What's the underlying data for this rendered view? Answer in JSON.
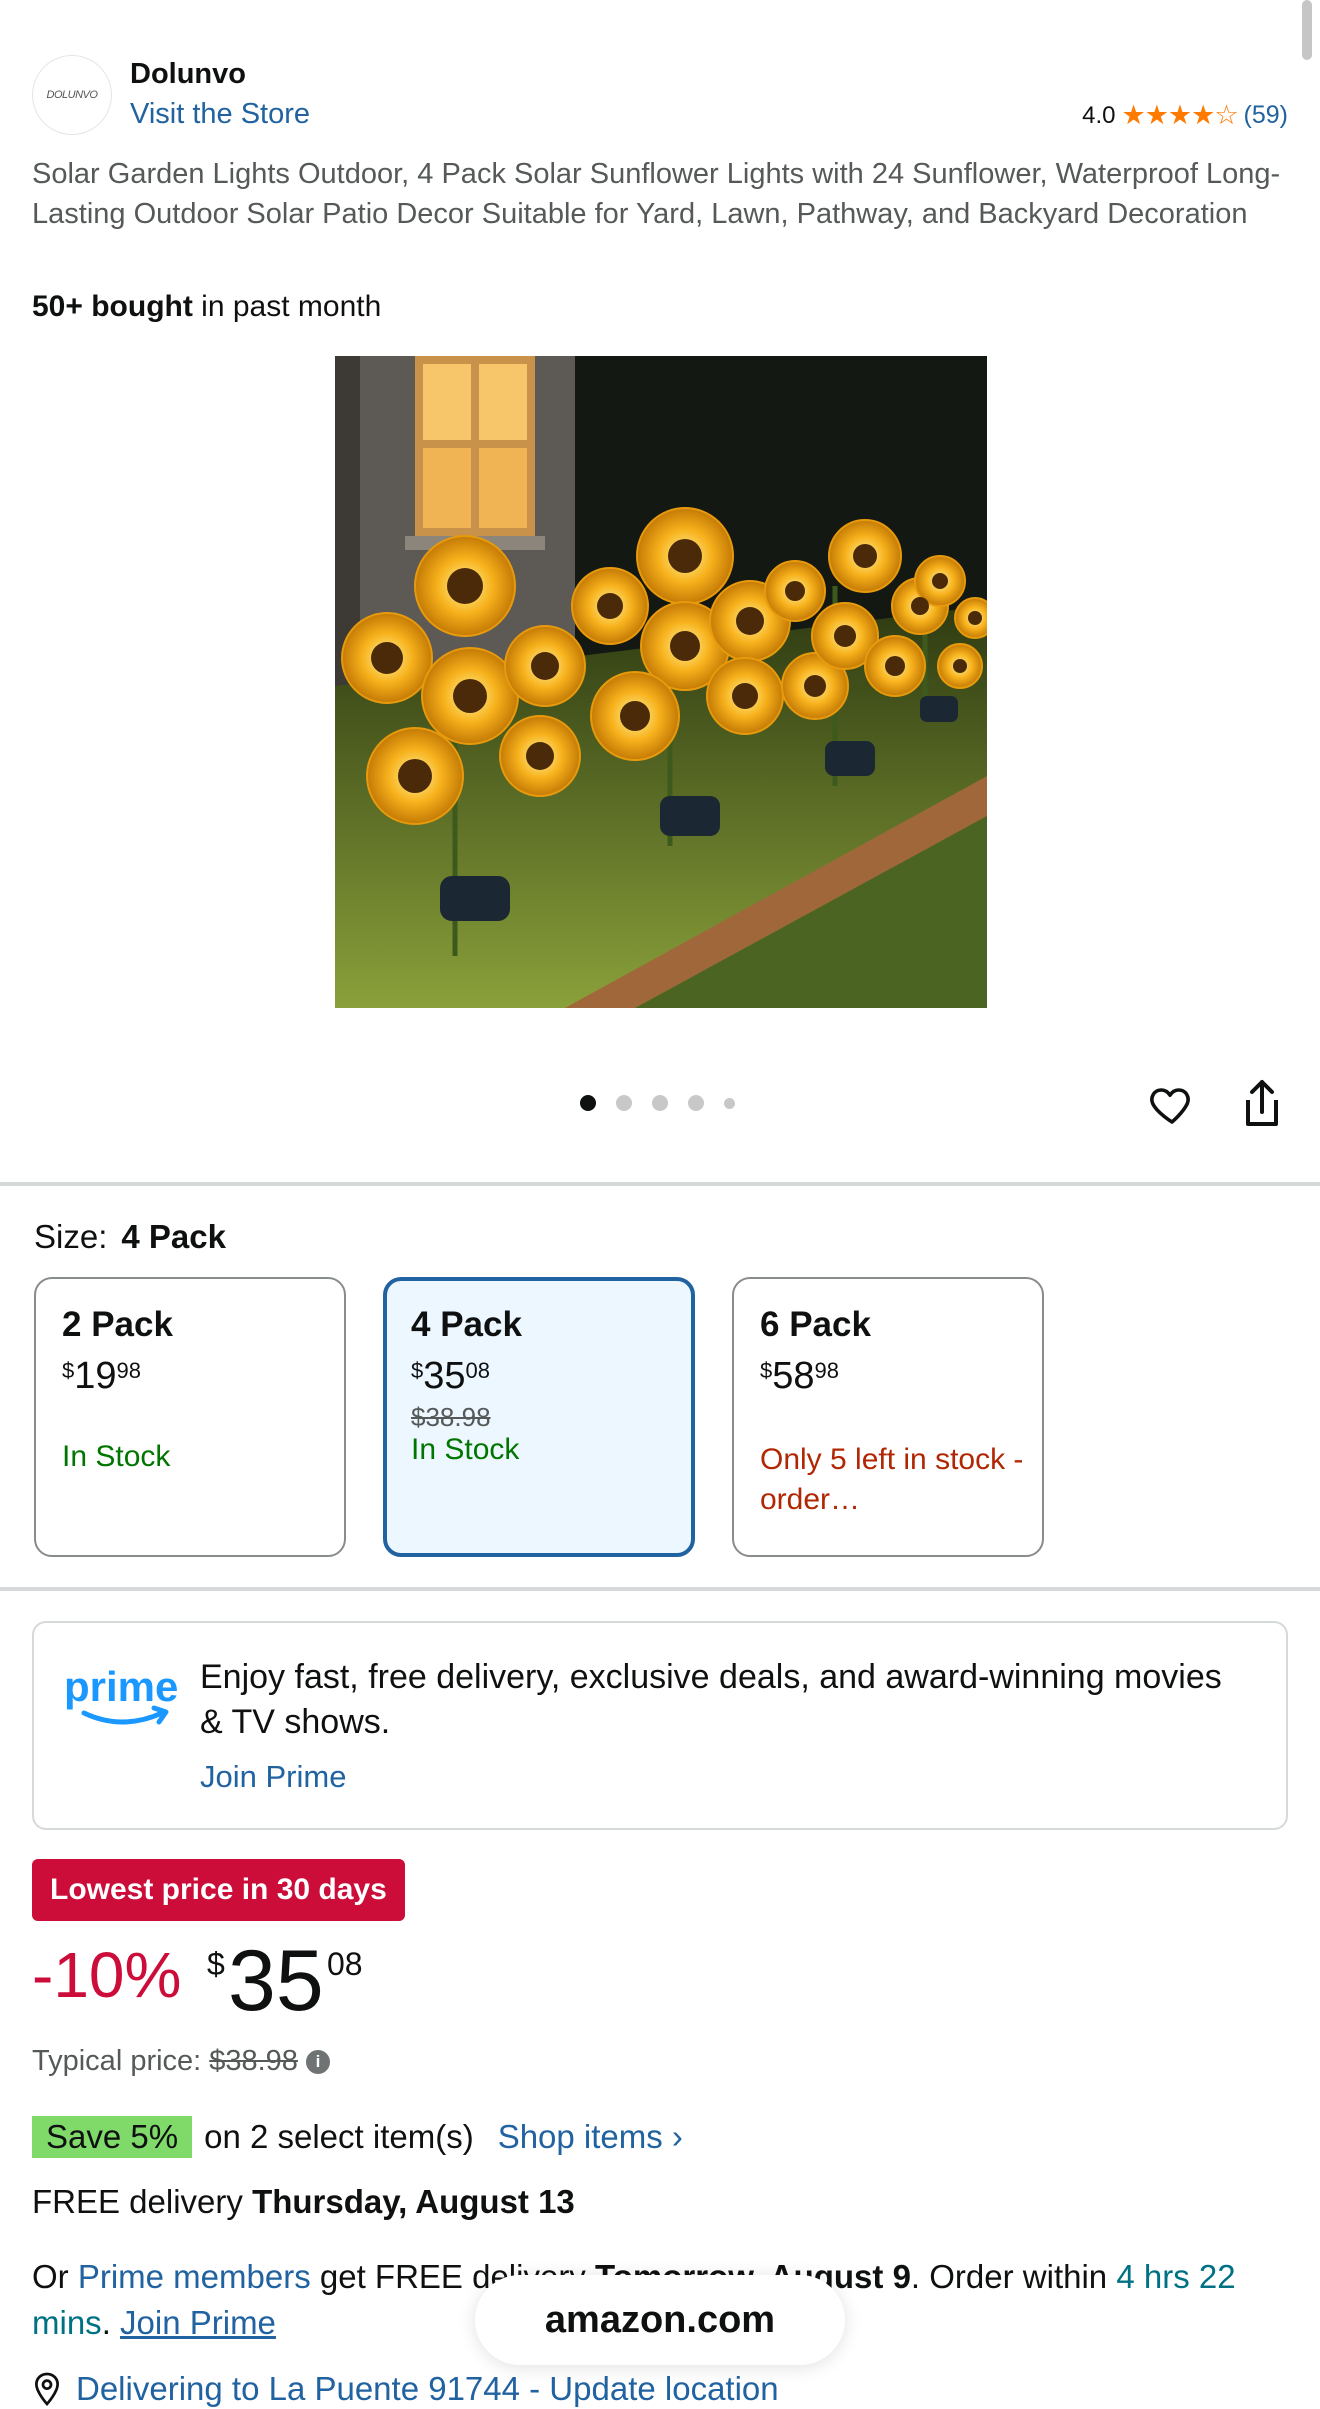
{
  "seller": {
    "logo_text": "DOLUNVO",
    "brand_name": "Dolunvo",
    "store_link": "Visit the Store",
    "rating_value": "4.0",
    "rating_stars": "★★★★☆",
    "rating_count": "(59)"
  },
  "product": {
    "title": "Solar Garden Lights Outdoor, 4 Pack Solar Sunflower Lights with 24 Sunflower, Waterproof Long-Lasting Outdoor Solar Patio Decor Suitable for Yard, Lawn, Pathway, and Backyard Decoration",
    "bought_bold": "50+ bought",
    "bought_rest": " in past month"
  },
  "carousel": {
    "dot_count": 5,
    "active_index": 0
  },
  "size": {
    "label": "Size:",
    "selected": "4 Pack",
    "options": [
      {
        "name": "2 Pack",
        "price_symbol": "$",
        "price_whole": "19",
        "price_fraction": "98",
        "strike": "",
        "stock": "In Stock",
        "stock_type": "in"
      },
      {
        "name": "4 Pack",
        "price_symbol": "$",
        "price_whole": "35",
        "price_fraction": "08",
        "strike": "$38.98",
        "stock": "In Stock",
        "stock_type": "in"
      },
      {
        "name": "6 Pack",
        "price_symbol": "$",
        "price_whole": "58",
        "price_fraction": "98",
        "strike": "",
        "stock": "Only 5 left in stock - order…",
        "stock_type": "low"
      }
    ]
  },
  "prime_promo": {
    "logo_text": "prime",
    "text": "Enjoy fast, free delivery, exclusive deals, and award-winning movies & TV shows.",
    "join_link": "Join Prime"
  },
  "pricing": {
    "deal_badge": "Lowest price in 30 days",
    "discount": "-10%",
    "price_symbol": "$",
    "price_whole": "35",
    "price_fraction": "08",
    "typical_label": "Typical price:",
    "typical_value": "$38.98",
    "info_icon": "i"
  },
  "promo": {
    "save_badge": "Save 5%",
    "save_text": "on 2 select item(s)",
    "shop_link": "Shop items ›"
  },
  "delivery": {
    "free_text": "FREE delivery ",
    "free_date": "Thursday, August 13",
    "prime_prefix": "Or ",
    "prime_members": "Prime members",
    "prime_mid": " get FREE delivery ",
    "prime_day": "Tomorrow, August 9",
    "order_within": ". Order within ",
    "time_left": "4 hrs 22 mins",
    "period": ". ",
    "join_link": "Join Prime"
  },
  "location": {
    "text": "Delivering to La Puente 91744 - Update location"
  },
  "browser": {
    "domain": "amazon.com"
  },
  "colors": {
    "link": "#2162a1",
    "star": "#ff7a00",
    "deal_red": "#cc0c39",
    "in_stock": "#007600",
    "low_stock": "#b12704",
    "save_green": "#7fda69",
    "selected_border": "#2162a1",
    "selected_bg": "#edf7ff"
  }
}
